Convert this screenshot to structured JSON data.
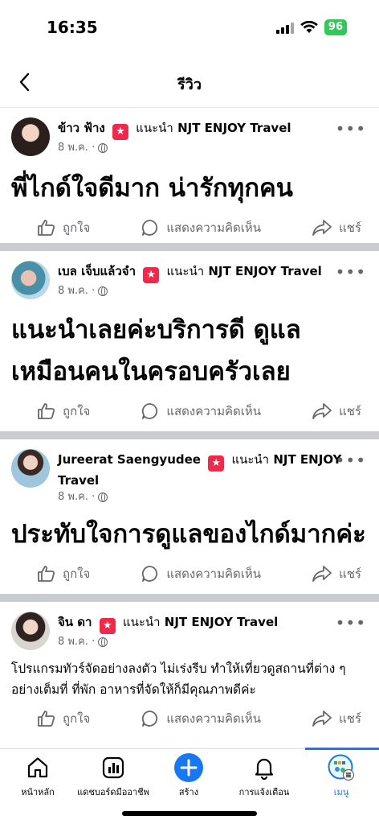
{
  "status_bar": {
    "time": "16:35",
    "battery": "96"
  },
  "header": {
    "title": "รีวิว"
  },
  "posts": [
    {
      "author": "ข้าว ฟ้าง",
      "recommend": "แนะนำ",
      "page": "NJT ENJOY Travel",
      "date": "8 พ.ค. ·",
      "text": "พี่ไกด์ใจดีมาก น่ารักทุกคน",
      "text_size": "big"
    },
    {
      "author": "เบล เจ็บแล้วจำ",
      "recommend": "แนะนำ",
      "page": "NJT ENJOY Travel",
      "date": "8 พ.ค. ·",
      "text": "แนะนำเลยค่ะบริการดี ดูแลเหมือนคนในครอบครัวเลย",
      "text_size": "big"
    },
    {
      "author": "Jureerat Saengyudee",
      "recommend": "แนะนำ",
      "page": "NJT ENJOY Travel",
      "date": "8 พ.ค. ·",
      "text": "ประทับใจการดูแลของไกด์มากค่ะ",
      "text_size": "big"
    },
    {
      "author": "จิน ดา",
      "recommend": "แนะนำ",
      "page": "NJT ENJOY Travel",
      "date": "8 พ.ค. ·",
      "text": "โปรแกรมทัวร์จัดอย่างลงตัว ไม่เร่งรีบ ทำให้เที่ยวดูสถานที่ต่าง ๆ อย่างเต็มที่ ที่พัก อาหารที่จัดให้ก็มีคุณภาพดีค่ะ",
      "text_size": "small"
    }
  ],
  "actions": {
    "like": "ถูกใจ",
    "comment": "แสดงความคิดเห็น",
    "share": "แชร์"
  },
  "bottom_nav": [
    {
      "label": "หน้าหลัก",
      "icon": "home-icon"
    },
    {
      "label": "แดชบอร์ดมืออาชีพ",
      "icon": "dashboard-icon"
    },
    {
      "label": "สร้าง",
      "icon": "create-plus-icon"
    },
    {
      "label": "การแจ้งเตือน",
      "icon": "bell-icon"
    },
    {
      "label": "เมนู",
      "icon": "menu-avatar-icon",
      "active": true
    }
  ],
  "colors": {
    "accent": "#1877f2",
    "badge": "#f0284a",
    "secondary_text": "#65676b",
    "separator": "#c9ccd1"
  }
}
